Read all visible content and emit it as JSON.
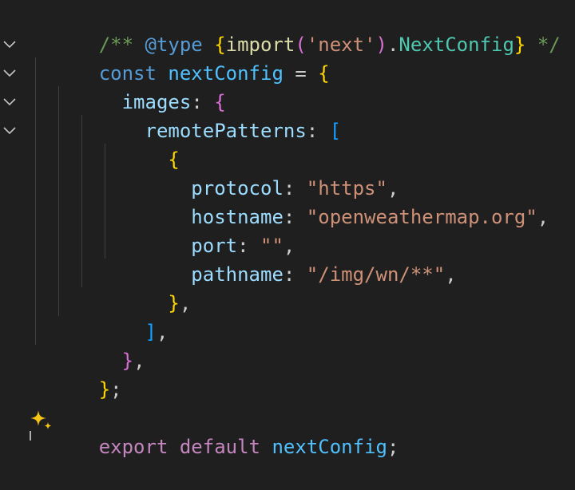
{
  "editor": {
    "lines": {
      "l1": {
        "comment_open": "/** ",
        "tag": "@type",
        "sp": " ",
        "brace_open": "{",
        "import_kw": "import",
        "paren_open": "(",
        "module": "'next'",
        "paren_close": ")",
        "dot": ".",
        "type_name": "NextConfig",
        "brace_close": "}",
        "comment_close": " */"
      },
      "l2": {
        "kw": "const",
        "sp": " ",
        "name": "nextConfig",
        "eq": " = ",
        "brace": "{"
      },
      "l3": {
        "indent": "  ",
        "key": "images",
        "colon": ": ",
        "brace": "{"
      },
      "l4": {
        "indent": "    ",
        "key": "remotePatterns",
        "colon": ": ",
        "bracket": "["
      },
      "l5": {
        "indent": "      ",
        "brace": "{"
      },
      "l6": {
        "indent": "        ",
        "key": "protocol",
        "colon": ": ",
        "value": "\"https\"",
        "comma": ","
      },
      "l7": {
        "indent": "        ",
        "key": "hostname",
        "colon": ": ",
        "value": "\"openweathermap.org\"",
        "comma": ","
      },
      "l8": {
        "indent": "        ",
        "key": "port",
        "colon": ": ",
        "value": "\"\"",
        "comma": ","
      },
      "l9": {
        "indent": "        ",
        "key": "pathname",
        "colon": ": ",
        "value": "\"/img/wn/**\"",
        "comma": ","
      },
      "l10": {
        "indent": "      ",
        "brace": "}",
        "comma": ","
      },
      "l11": {
        "indent": "    ",
        "bracket": "]",
        "comma": ","
      },
      "l12": {
        "indent": "  ",
        "brace": "}",
        "comma": ","
      },
      "l13": {
        "brace": "}",
        "semi": ";"
      },
      "l15": {
        "export_kw": "export",
        "sp1": " ",
        "default_kw": "default",
        "sp2": " ",
        "name": "nextConfig",
        "semi": ";"
      }
    },
    "fold_icon": "chevron-down-icon",
    "sparkle_icon": "sparkle-icon"
  }
}
